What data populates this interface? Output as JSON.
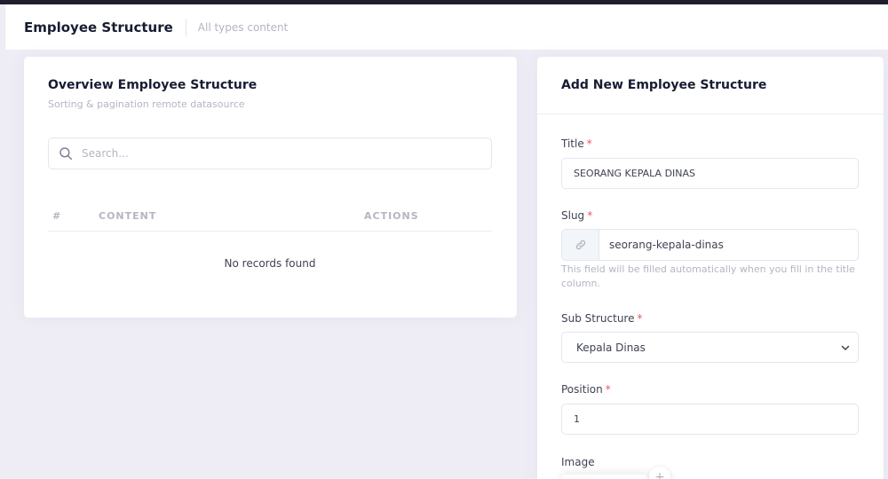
{
  "subheader": {
    "title": "Employee Structure",
    "description": "All types content"
  },
  "overview": {
    "title": "Overview Employee Structure",
    "subtitle": "Sorting & pagination remote datasource",
    "search_placeholder": "Search...",
    "columns": [
      "#",
      "CONTENT",
      "ACTIONS"
    ],
    "empty_text": "No records found"
  },
  "form": {
    "title": "Add New Employee Structure",
    "required_mark": "*",
    "title_field": {
      "label": "Title",
      "value": "SEORANG KEPALA DINAS"
    },
    "slug_field": {
      "label": "Slug",
      "value": "seorang-kepala-dinas",
      "help": "This field will be filled automatically when you fill in the title column."
    },
    "sub_structure_field": {
      "label": "Sub Structure",
      "selected": "Kepala Dinas"
    },
    "position_field": {
      "label": "Position",
      "value": "1"
    },
    "image_field": {
      "label": "Image",
      "add_symbol": "+"
    }
  },
  "colors": {
    "required": "#f64e60",
    "muted": "#b5b5c3",
    "heading": "#181c32",
    "background": "#eeedf5"
  },
  "icons": {
    "search": "search-icon",
    "slug_addon": "link-icon",
    "select": "chevron-down-icon"
  }
}
